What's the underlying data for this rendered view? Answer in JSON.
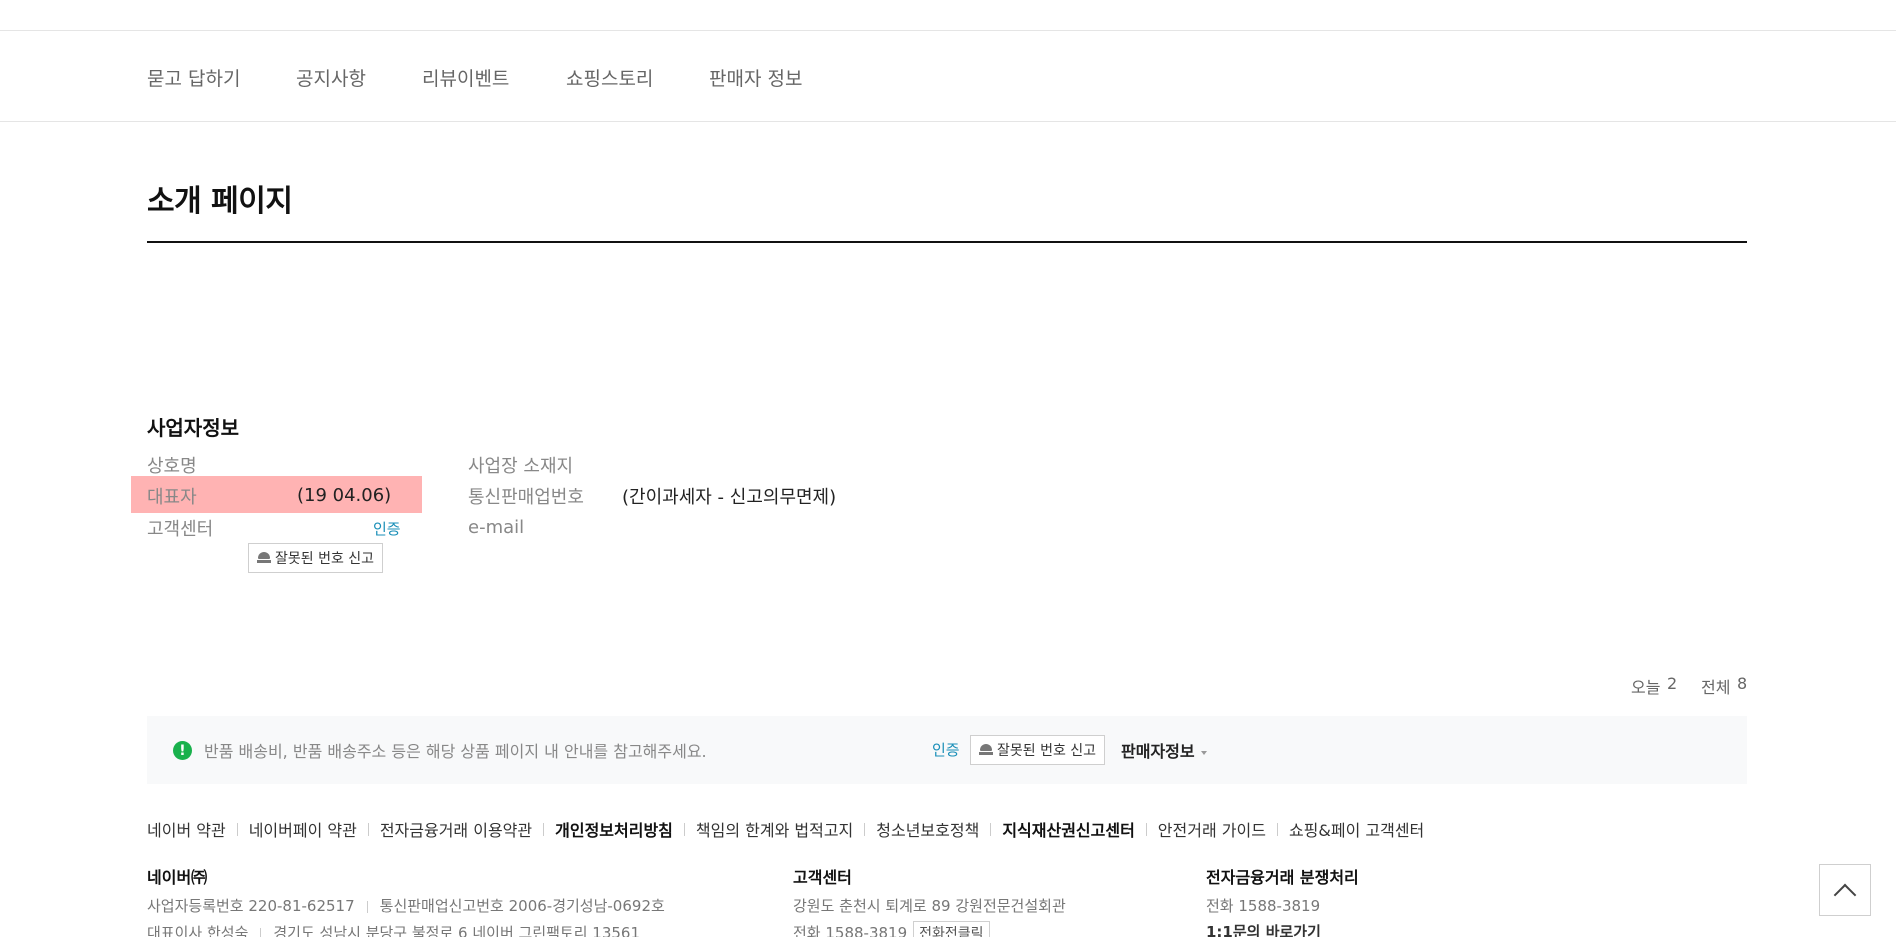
{
  "nav": {
    "items": [
      "묻고 답하기",
      "공지사항",
      "리뷰이벤트",
      "쇼핑스토리",
      "판매자 정보"
    ]
  },
  "page_title": "소개 페이지",
  "business": {
    "title": "사업자정보",
    "labels": {
      "company": "상호명",
      "representative": "대표자",
      "customer_center": "고객센터",
      "address": "사업장 소재지",
      "mail_order": "통신판매업번호",
      "email": "e-mail"
    },
    "representative_value": "(19     04.06)",
    "mail_order_value": "(간이과세자 - 신고의무면제)",
    "cert_label": "인증",
    "report_button": "잘못된 번호 신고"
  },
  "visits": {
    "today_label": "오늘",
    "today_value": "2",
    "total_label": "전체",
    "total_value": "8"
  },
  "notice": {
    "icon": "!",
    "text": "반품 배송비, 반품 배송주소 등은 해당 상품 페이지 내 안내를 참고해주세요.",
    "cert_label": "인증",
    "report_button": "잘못된 번호 신고",
    "seller_info": "판매자정보"
  },
  "footer_links": [
    "네이버 약관",
    "네이버페이 약관",
    "전자금융거래 이용약관",
    "개인정보처리방침",
    "책임의 한계와 법적고지",
    "청소년보호정책",
    "지식재산권신고센터",
    "안전거래 가이드",
    "쇼핑&페이 고객센터"
  ],
  "footer": {
    "company": {
      "title": "네이버㈜",
      "line1_a": "사업자등록번호 220-81-62517",
      "line1_b": "통신판매업신고번호 2006-경기성남-0692호",
      "line2_a": "대표이사 한성숙",
      "line2_b": "경기도 성남시 분당구 불정로 6 네이버 그린팩토리 13561"
    },
    "customer": {
      "title": "고객센터",
      "line1": "강원도 춘천시 퇴계로 89 강원전문건설회관",
      "line2": "전화 1588-3819",
      "call_button": "전화전클릭"
    },
    "dispute": {
      "title": "전자금융거래 분쟁처리",
      "line1": "전화 1588-3819",
      "line2": "1:1문의 바로가기"
    }
  }
}
